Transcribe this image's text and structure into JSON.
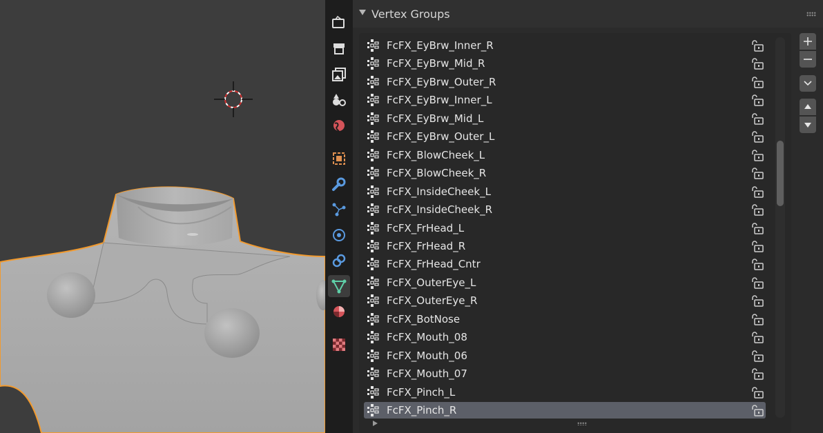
{
  "properties_panel": {
    "title": "Vertex Groups",
    "vertex_groups": [
      {
        "label": "FcFX_EyBrw_Inner_R"
      },
      {
        "label": "FcFX_EyBrw_Mid_R"
      },
      {
        "label": "FcFX_EyBrw_Outer_R"
      },
      {
        "label": "FcFX_EyBrw_Inner_L"
      },
      {
        "label": "FcFX_EyBrw_Mid_L"
      },
      {
        "label": "FcFX_EyBrw_Outer_L"
      },
      {
        "label": "FcFX_BlowCheek_L"
      },
      {
        "label": "FcFX_BlowCheek_R"
      },
      {
        "label": "FcFX_InsideCheek_L"
      },
      {
        "label": "FcFX_InsideCheek_R"
      },
      {
        "label": "FcFX_FrHead_L"
      },
      {
        "label": "FcFX_FrHead_R"
      },
      {
        "label": "FcFX_FrHead_Cntr"
      },
      {
        "label": "FcFX_OuterEye_L"
      },
      {
        "label": "FcFX_OuterEye_R"
      },
      {
        "label": "FcFX_BotNose"
      },
      {
        "label": "FcFX_Mouth_08"
      },
      {
        "label": "FcFX_Mouth_06"
      },
      {
        "label": "FcFX_Mouth_07"
      },
      {
        "label": "FcFX_Pinch_L"
      },
      {
        "label": "FcFX_Pinch_R"
      }
    ],
    "selected_index": 20
  },
  "tab_icons": [
    "render-icon",
    "output-icon",
    "view-layer-icon",
    "scene-icon",
    "world-icon",
    "object-icon",
    "modifier-icon",
    "particles-icon",
    "physics-icon",
    "constraints-icon",
    "object-data-icon",
    "material-icon",
    "texture-icon"
  ],
  "side_buttons": [
    "add-icon",
    "remove-icon",
    "specials-icon",
    "move-up-icon",
    "move-down-icon"
  ],
  "colors": {
    "selection_outline": "#f29a2e",
    "active_row": "#5c5f68",
    "accent_green": "#5fd0a8"
  }
}
